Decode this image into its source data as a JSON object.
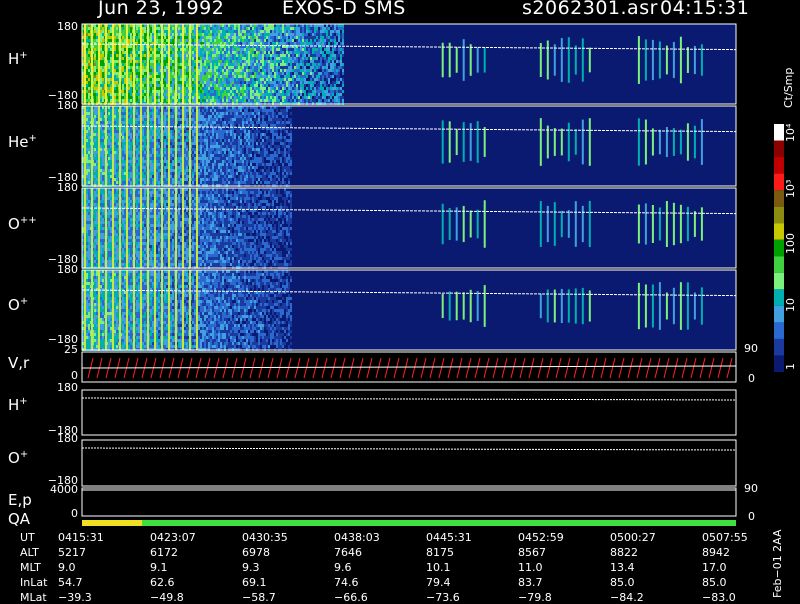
{
  "header": {
    "date": "Jun 23, 1992",
    "instrument": "EXOS-D SMS",
    "file": "s2062301.asr",
    "start_time": "04:15:31"
  },
  "panels": [
    {
      "label": "H",
      "sup": "+",
      "top": "180",
      "bottom": "−180"
    },
    {
      "label": "He",
      "sup": "+",
      "top": "180",
      "bottom": "−180"
    },
    {
      "label": "O",
      "sup": "++",
      "top": "180",
      "bottom": "−180"
    },
    {
      "label": "O",
      "sup": "+",
      "top": "180",
      "bottom": "−180"
    }
  ],
  "vr_panel": {
    "label": "V,r",
    "top": "25",
    "bottom": "0",
    "right_top": "90",
    "right_bottom": "0"
  },
  "h_line_panel": {
    "label": "H",
    "sup": "+",
    "top": "180",
    "bottom": "−180"
  },
  "o_line_panel": {
    "label": "O",
    "sup": "+",
    "top": "180",
    "bottom": "−180"
  },
  "ep_panel": {
    "label": "E,p",
    "top": "4000",
    "bottom": "0",
    "right": "90"
  },
  "qa_panel": {
    "label": "QA",
    "bottom": "0",
    "right": "0"
  },
  "colorbar": {
    "unit": "Ct/Smp",
    "labels": [
      "10⁴",
      "10³",
      "100",
      "10",
      "1"
    ],
    "colors": [
      "#ffffff",
      "#8b0000",
      "#c00000",
      "#ff1a1a",
      "#7a5a10",
      "#8c8c10",
      "#c8c800",
      "#00a000",
      "#40d040",
      "#7cf07c",
      "#00b0b0",
      "#40a0e0",
      "#2a6ad0",
      "#1a3aa0",
      "#0a1a70"
    ]
  },
  "table": {
    "row_labels": [
      "UT",
      "ALT",
      "MLT",
      "InLat",
      "MLat"
    ],
    "columns": [
      {
        "UT": "0415:31",
        "ALT": "5217",
        "MLT": "9.0",
        "InLat": "54.7",
        "MLat": "−39.3"
      },
      {
        "UT": "0423:07",
        "ALT": "6172",
        "MLT": "9.1",
        "InLat": "62.6",
        "MLat": "−49.8"
      },
      {
        "UT": "0430:35",
        "ALT": "6978",
        "MLT": "9.3",
        "InLat": "69.1",
        "MLat": "−58.7"
      },
      {
        "UT": "0438:03",
        "ALT": "7646",
        "MLT": "9.6",
        "InLat": "74.6",
        "MLat": "−66.6"
      },
      {
        "UT": "0445:31",
        "ALT": "8175",
        "MLT": "10.1",
        "InLat": "79.4",
        "MLat": "−73.6"
      },
      {
        "UT": "0452:59",
        "ALT": "8567",
        "MLT": "11.0",
        "InLat": "83.7",
        "MLat": "−79.8"
      },
      {
        "UT": "0500:27",
        "ALT": "8822",
        "MLT": "13.4",
        "InLat": "85.0",
        "MLat": "−84.2"
      },
      {
        "UT": "0507:55",
        "ALT": "8942",
        "MLT": "17.0",
        "InLat": "85.0",
        "MLat": "−83.0"
      }
    ]
  },
  "footer_vertical": "Feb−01 2AA",
  "chart_data": {
    "type": "heatmap",
    "title": "Jun 23, 1992   EXOS-D SMS",
    "x": {
      "ticks": [
        "0415:31",
        "0423:07",
        "0430:35",
        "0438:03",
        "0445:31",
        "0452:59",
        "0500:27",
        "0507:55"
      ]
    },
    "y_range": [
      -180,
      180
    ],
    "series": [
      {
        "name": "H+"
      },
      {
        "name": "He+"
      },
      {
        "name": "O++"
      },
      {
        "name": "O+"
      }
    ],
    "colorbar_unit": "Ct/Smp",
    "colorbar_ticks": [
      "1",
      "10",
      "100",
      "10³",
      "10⁴"
    ]
  }
}
